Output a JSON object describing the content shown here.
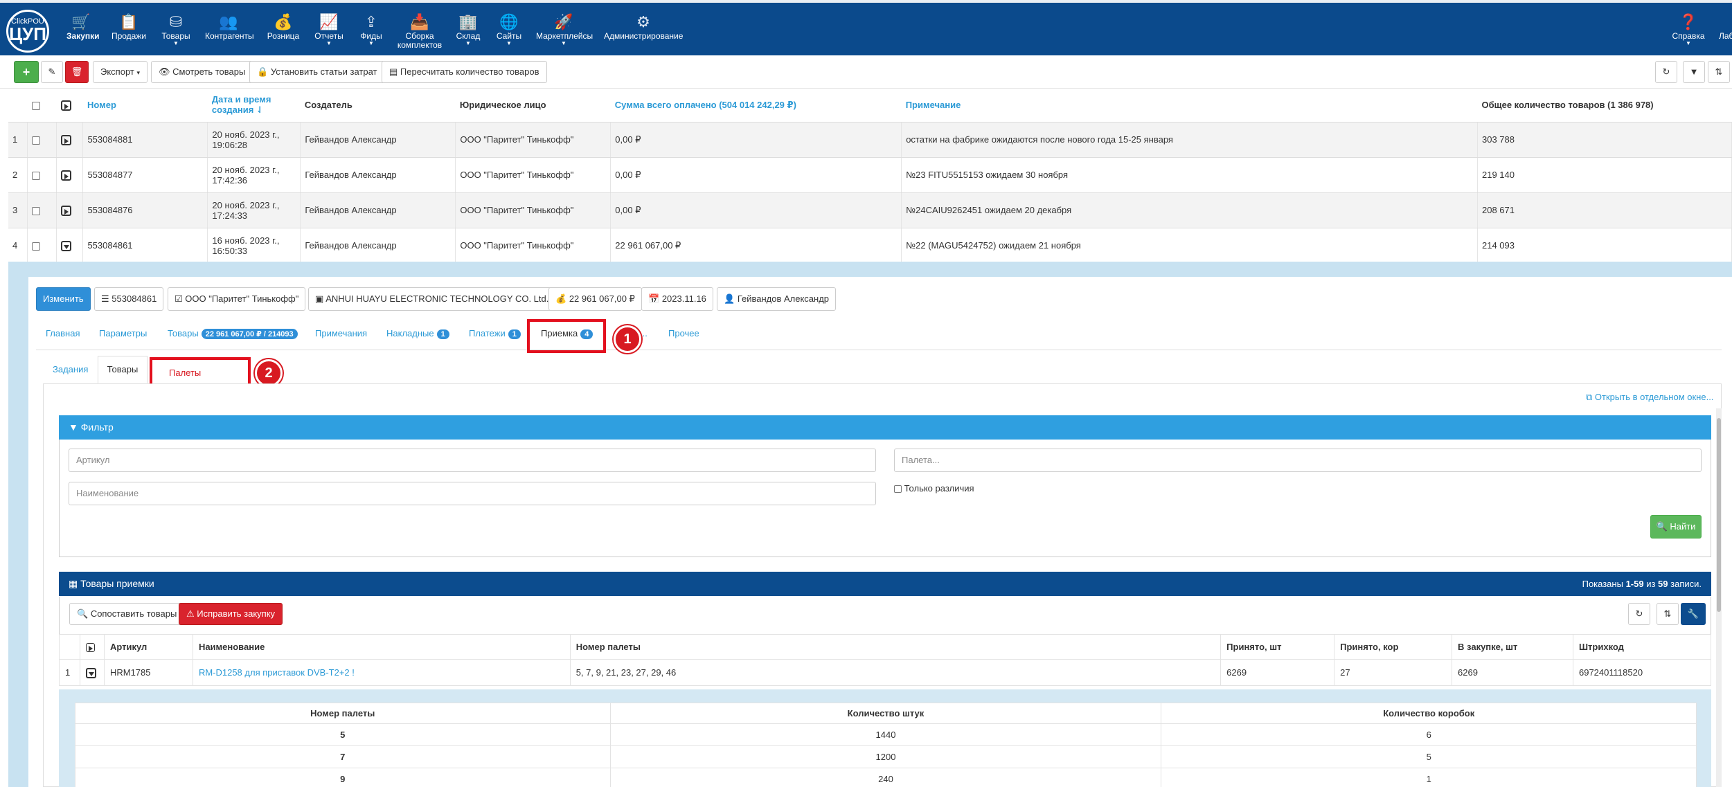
{
  "logo": {
    "top": "ClickPOU",
    "bottom": "ЦУП"
  },
  "nav": [
    {
      "label": "Закупки",
      "icon": "cart-icon",
      "glyph": "🛒"
    },
    {
      "label": "Продажи",
      "icon": "clipboard-icon",
      "glyph": "📋"
    },
    {
      "label": "Товары",
      "icon": "boxes-icon",
      "glyph": "⛁"
    },
    {
      "label": "Контрагенты",
      "icon": "users-icon",
      "glyph": "👥"
    },
    {
      "label": "Розница",
      "icon": "money-bag-icon",
      "glyph": "💰"
    },
    {
      "label": "Отчеты",
      "icon": "chart-icon",
      "glyph": "📈"
    },
    {
      "label": "Фиды",
      "icon": "upload-icon",
      "glyph": "⇪"
    },
    {
      "label": "Сборка комплектов",
      "icon": "inbox-icon",
      "glyph": "📥"
    },
    {
      "label": "Склад",
      "icon": "building-icon",
      "glyph": "🏢"
    },
    {
      "label": "Сайты",
      "icon": "globe-icon",
      "glyph": "🌐"
    },
    {
      "label": "Маркетплейсы",
      "icon": "rocket-icon",
      "glyph": "🚀"
    },
    {
      "label": "Администрирование",
      "icon": "gears-icon",
      "glyph": "⚙"
    },
    {
      "label": "Справка",
      "icon": "help-icon",
      "glyph": "❓"
    },
    {
      "label": "Лаб",
      "icon": "lab-icon",
      "glyph": ""
    }
  ],
  "toolbar": {
    "add": "+",
    "export": "Экспорт",
    "view_goods": "Смотреть товары",
    "set_costs": "Установить статьи затрат",
    "recount": "Пересчитать количество товаров"
  },
  "orders": {
    "headers": {
      "number": "Номер",
      "date": "Дата и время создания",
      "creator": "Создатель",
      "entity": "Юридическое лицо",
      "paid": "Сумма всего оплачено (504 014 242,29 ₽)",
      "note": "Примечание",
      "total": "Общее количество товаров (1 386 978)"
    },
    "rows": [
      {
        "idx": "1",
        "number": "553084881",
        "date1": "20 нояб. 2023 г.,",
        "date2": "19:06:28",
        "creator": "Гейвандов Александр",
        "entity": "ООО \"Паритет\" Тинькофф\"",
        "paid": "0,00 ₽",
        "note": "остатки на фабрике ожидаются после нового года 15-25 января",
        "total": "303 788"
      },
      {
        "idx": "2",
        "number": "553084877",
        "date1": "20 нояб. 2023 г.,",
        "date2": "17:42:36",
        "creator": "Гейвандов Александр",
        "entity": "ООО \"Паритет\" Тинькофф\"",
        "paid": "0,00 ₽",
        "note": "№23 FITU5515153 ожидаем 30 ноября",
        "total": "219 140"
      },
      {
        "idx": "3",
        "number": "553084876",
        "date1": "20 нояб. 2023 г.,",
        "date2": "17:24:33",
        "creator": "Гейвандов Александр",
        "entity": "ООО \"Паритет\" Тинькофф\"",
        "paid": "0,00 ₽",
        "note": "№24CAIU9262451 ожидаем 20 декабря",
        "total": "208 671"
      },
      {
        "idx": "4",
        "number": "553084861",
        "date1": "16 нояб. 2023 г.,",
        "date2": "16:50:33",
        "creator": "Гейвандов Александр",
        "entity": "ООО \"Паритет\" Тинькофф\"",
        "paid": "22 961 067,00 ₽",
        "note": "№22 (MAGU5424752) ожидаем 21 ноября",
        "total": "214 093"
      }
    ]
  },
  "detail": {
    "edit": "Изменить",
    "chips": {
      "number": "553084861",
      "entity": "ООО \"Паритет\" Тинькофф\"",
      "supplier": "ANHUI HUAYU ELECTRONIC TECHNOLOGY CO. Ltd.",
      "sum": "22 961 067,00 ₽",
      "date": "2023.11.16",
      "user": "Гейвандов Александр"
    },
    "tabs": {
      "main": "Главная",
      "params": "Параметры",
      "goods": "Товары",
      "goods_badge": "22 961 067,00 ₽ / 214093",
      "notes": "Примечания",
      "invoices": "Накладные",
      "invoices_badge": "1",
      "payments": "Платежи",
      "payments_badge": "1",
      "receiving": "Приемка",
      "receiving_badge": "4",
      "hidden": "...",
      "other": "Прочее"
    },
    "subtabs": {
      "tasks": "Задания",
      "goods": "Товары",
      "pallets": "Палеты"
    },
    "markers": {
      "one": "1",
      "two": "2"
    },
    "open_window": "Открыть в отдельном окне...",
    "filter": {
      "title": "Фильтр",
      "article_ph": "Артикул",
      "name_ph": "Наименование",
      "pallet_ph": "Палета...",
      "only_diff": "Только различия",
      "find": "Найти"
    },
    "goods_panel": {
      "title": "Товары приемки",
      "shown_prefix": "Показаны ",
      "shown_range": "1-59",
      "shown_mid": " из ",
      "shown_total": "59",
      "shown_suffix": " записи.",
      "match": "Сопоставить товары",
      "fix": "Исправить закупку",
      "headers": {
        "article": "Артикул",
        "name": "Наименование",
        "pallet": "Номер палеты",
        "accepted_pcs": "Принято, шт",
        "accepted_box": "Принято, кор",
        "in_purchase": "В закупке, шт",
        "barcode": "Штрихкод"
      },
      "row": {
        "idx": "1",
        "article": "HRM1785",
        "name": "RM-D1258 для приставок DVB-T2+2 !",
        "pallets": "5, 7, 9, 21, 23, 27, 29, 46",
        "accepted_pcs": "6269",
        "accepted_box": "27",
        "in_purchase": "6269",
        "barcode": "6972401118520"
      }
    },
    "pallets": {
      "headers": {
        "num": "Номер палеты",
        "pcs": "Количество штук",
        "boxes": "Количество коробок"
      },
      "rows": [
        {
          "num": "5",
          "pcs": "1440",
          "boxes": "6"
        },
        {
          "num": "7",
          "pcs": "1200",
          "boxes": "5"
        },
        {
          "num": "9",
          "pcs": "240",
          "boxes": "1"
        }
      ]
    }
  }
}
